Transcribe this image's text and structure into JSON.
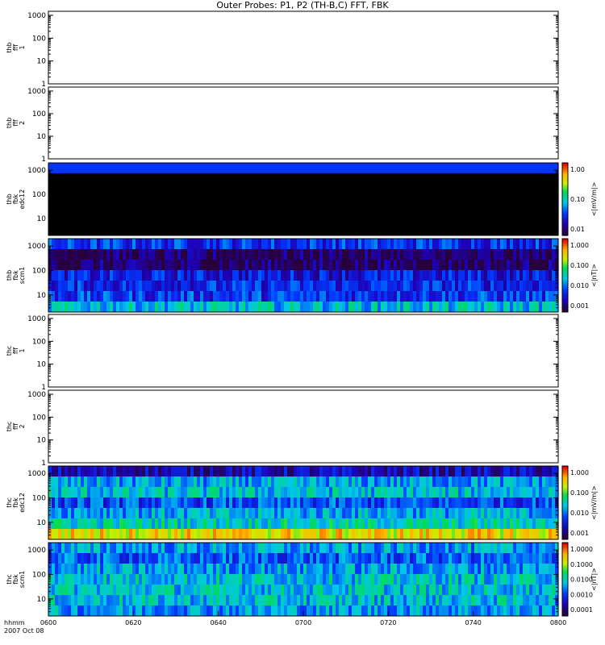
{
  "title": "Outer Probes: P1, P2 (TH-B,C) FFT, FBK",
  "time_axis": {
    "label_line1": "hhmm",
    "label_line2": "2007 Oct 08",
    "ticks": [
      "0600",
      "0620",
      "0640",
      "0700",
      "0720",
      "0740",
      "0800"
    ]
  },
  "chart_data": [
    {
      "type": "heatmap",
      "panel": "thb_fff_1",
      "label": [
        "thb",
        "fff",
        "1"
      ],
      "yscale": "log",
      "ylim": [
        1,
        1500
      ],
      "yticks": [
        "1000",
        "100",
        "10",
        "1"
      ],
      "filled": false
    },
    {
      "type": "heatmap",
      "panel": "thb_fff_2",
      "label": [
        "thb",
        "fff",
        "2"
      ],
      "yscale": "log",
      "ylim": [
        1,
        1500
      ],
      "yticks": [
        "1000",
        "100",
        "10",
        "1"
      ],
      "filled": false
    },
    {
      "type": "heatmap",
      "panel": "thb_fbk_edc12",
      "label": [
        "thb",
        "fbk",
        "edc12"
      ],
      "yscale": "log",
      "ylim": [
        2,
        2000
      ],
      "yticks": [
        "1000",
        "100",
        "10"
      ],
      "filled": true,
      "colorbar": {
        "label": "<|mV/m|>",
        "ticks": [
          "1.00",
          "0.10",
          "0.01"
        ]
      }
    },
    {
      "type": "heatmap",
      "panel": "thb_fbk_scm1",
      "label": [
        "thb",
        "fbk",
        "scm1"
      ],
      "yscale": "log",
      "ylim": [
        2,
        2000
      ],
      "yticks": [
        "1000",
        "100",
        "10"
      ],
      "filled": true,
      "colorbar": {
        "label": "<|nT|>",
        "ticks": [
          "1.000",
          "0.100",
          "0.010",
          "0.001"
        ]
      }
    },
    {
      "type": "heatmap",
      "panel": "thc_fff_1",
      "label": [
        "thc",
        "fff",
        "1"
      ],
      "yscale": "log",
      "ylim": [
        1,
        1500
      ],
      "yticks": [
        "1000",
        "100",
        "10",
        "1"
      ],
      "filled": false
    },
    {
      "type": "heatmap",
      "panel": "thc_fff_2",
      "label": [
        "thc",
        "fff",
        "2"
      ],
      "yscale": "log",
      "ylim": [
        1,
        1500
      ],
      "yticks": [
        "1000",
        "100",
        "10",
        "1"
      ],
      "filled": false
    },
    {
      "type": "heatmap",
      "panel": "thc_fbk_edc12",
      "label": [
        "thc",
        "fbk",
        "edc12"
      ],
      "yscale": "log",
      "ylim": [
        2,
        2000
      ],
      "yticks": [
        "1000",
        "100",
        "10"
      ],
      "filled": true,
      "colorbar": {
        "label": "<|mV/m|>",
        "ticks": [
          "1.000",
          "0.100",
          "0.010",
          "0.001"
        ]
      }
    },
    {
      "type": "heatmap",
      "panel": "thc_fbk_scm1",
      "label": [
        "thc",
        "fbk",
        "scm1"
      ],
      "yscale": "log",
      "ylim": [
        2,
        2000
      ],
      "yticks": [
        "1000",
        "100",
        "10"
      ],
      "filled": true,
      "colorbar": {
        "label": "<|nT|>",
        "ticks": [
          "1.0000",
          "0.1000",
          "0.0100",
          "0.0010",
          "0.0001"
        ]
      }
    }
  ]
}
